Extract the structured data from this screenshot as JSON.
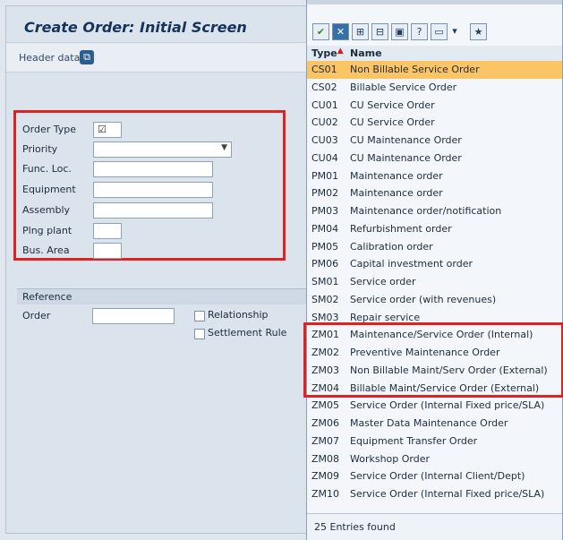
{
  "screen": {
    "title": "Create Order: Initial Screen",
    "header_data_label": "Header data"
  },
  "form": {
    "order_type_label": "Order Type",
    "priority_label": "Priority",
    "func_loc_label": "Func. Loc.",
    "equipment_label": "Equipment",
    "assembly_label": "Assembly",
    "plng_plant_label": "Plng plant",
    "bus_area_label": "Bus. Area"
  },
  "reference": {
    "section_label": "Reference",
    "order_label": "Order",
    "relationship_label": "Relationship",
    "settlement_rule_label": "Settlement Rule"
  },
  "popup": {
    "col_type": "Type",
    "col_name": "Name",
    "entries": [
      {
        "type": "CS01",
        "name": "Non Billable Service Order"
      },
      {
        "type": "CS02",
        "name": "Billable Service Order"
      },
      {
        "type": "CU01",
        "name": "CU Service Order"
      },
      {
        "type": "CU02",
        "name": "CU Service Order"
      },
      {
        "type": "CU03",
        "name": "CU Maintenance Order"
      },
      {
        "type": "CU04",
        "name": "CU Maintenance Order"
      },
      {
        "type": "PM01",
        "name": "Maintenance order"
      },
      {
        "type": "PM02",
        "name": "Maintenance order"
      },
      {
        "type": "PM03",
        "name": "Maintenance order/notification"
      },
      {
        "type": "PM04",
        "name": "Refurbishment order"
      },
      {
        "type": "PM05",
        "name": "Calibration order"
      },
      {
        "type": "PM06",
        "name": "Capital investment order"
      },
      {
        "type": "SM01",
        "name": "Service order"
      },
      {
        "type": "SM02",
        "name": "Service order (with revenues)"
      },
      {
        "type": "SM03",
        "name": "Repair service"
      },
      {
        "type": "ZM01",
        "name": "Maintenance/Service Order (Internal)"
      },
      {
        "type": "ZM02",
        "name": "Preventive Maintenance Order"
      },
      {
        "type": "ZM03",
        "name": "Non Billable Maint/Serv Order (External)"
      },
      {
        "type": "ZM04",
        "name": "Billable Maint/Service Order (External)"
      },
      {
        "type": "ZM05",
        "name": "Service Order (Internal Fixed price/SLA)"
      },
      {
        "type": "ZM06",
        "name": "Master Data Maintenance Order"
      },
      {
        "type": "ZM07",
        "name": "Equipment Transfer Order"
      },
      {
        "type": "ZM08",
        "name": "Workshop Order"
      },
      {
        "type": "ZM09",
        "name": "Service Order (Internal Client/Dept)"
      },
      {
        "type": "ZM10",
        "name": "Service Order (Internal Fixed price/SLA)"
      }
    ],
    "footer": "25 Entries found"
  },
  "colors": {
    "highlight": "#e22121",
    "selected_row": "#fbc565"
  }
}
